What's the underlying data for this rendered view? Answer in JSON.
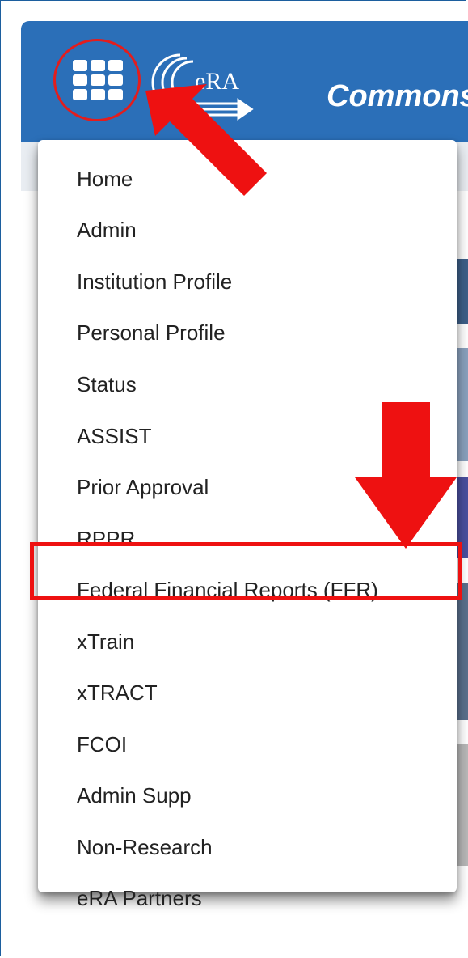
{
  "header": {
    "app_title": "Commons",
    "logo_text": "eRA",
    "apps_button_icon": "grid-icon"
  },
  "menu": {
    "items": [
      {
        "label": "Home"
      },
      {
        "label": "Admin"
      },
      {
        "label": "Institution Profile"
      },
      {
        "label": "Personal Profile"
      },
      {
        "label": "Status"
      },
      {
        "label": "ASSIST"
      },
      {
        "label": "Prior Approval"
      },
      {
        "label": "RPPR"
      },
      {
        "label": "Federal Financial Reports (FFR)"
      },
      {
        "label": "xTrain"
      },
      {
        "label": "xTRACT"
      },
      {
        "label": "FCOI"
      },
      {
        "label": "Admin Supp"
      },
      {
        "label": "Non-Research"
      },
      {
        "label": "eRA Partners"
      }
    ],
    "highlighted_item": "Federal Financial Reports (FFR)"
  },
  "annotations": {
    "color": "#ee1111",
    "arrows": [
      "arrow-to-apps-menu",
      "arrow-to-ffr-item"
    ]
  },
  "colors": {
    "header_bg": "#2b6fb8",
    "highlight": "#ee1111"
  }
}
